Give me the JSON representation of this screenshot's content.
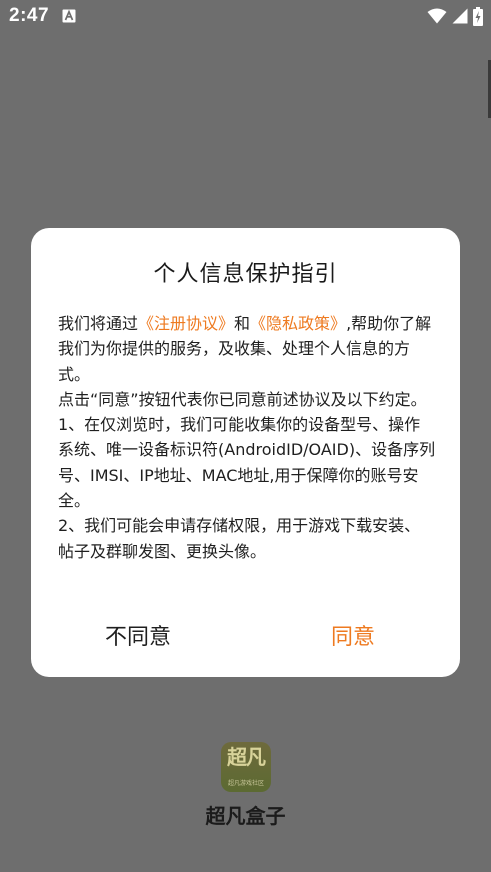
{
  "status_bar": {
    "time": "2:47",
    "notification_icon": "a-font-icon",
    "icons": [
      "wifi-icon",
      "signal-icon",
      "battery-charging-icon"
    ]
  },
  "dialog": {
    "title": "个人信息保护指引",
    "para1_prefix": "我们将通过",
    "terms_link": "《注册协议》",
    "para1_and": "和",
    "privacy_link": "《隐私政策》",
    "para1_suffix": ",帮助你了解我们为你提供的服务，及收集、处理个人信息的方式。",
    "para2": "点击“同意”按钮代表你已同意前述协议及以下约定。",
    "para3": "1、在仅浏览时，我们可能收集你的设备型号、操作系统、唯一设备标识符(AndroidID/OAID)、设备序列号、IMSI、IP地址、MAC地址,用于保障你的账号安全。",
    "para4": "2、我们可能会申请存储权限，用于游戏下载安装、帖子及群聊发图、更换头像。",
    "disagree_label": "不同意",
    "agree_label": "同意"
  },
  "app": {
    "logo_text": "超凡",
    "logo_subtext": "超凡游戏社区",
    "name": "超凡盒子"
  },
  "colors": {
    "accent": "#ee7a20",
    "overlay": "#6e6e6e"
  }
}
